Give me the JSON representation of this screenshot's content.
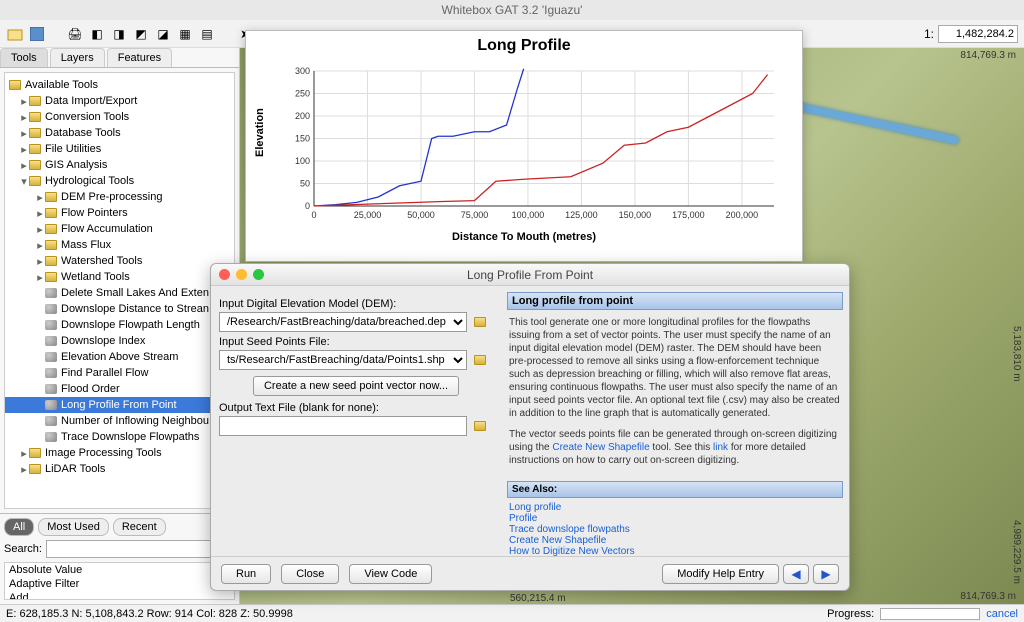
{
  "window_title": "Whitebox GAT 3.2 'Iguazu'",
  "scale_label": "1:",
  "scale_value": "1,482,284.2",
  "tabs": {
    "tools": "Tools",
    "layers": "Layers",
    "features": "Features"
  },
  "tree": {
    "root": "Available Tools",
    "data_import": "Data Import/Export",
    "conversion": "Conversion Tools",
    "database": "Database Tools",
    "file_util": "File Utilities",
    "gis": "GIS Analysis",
    "hydro": "Hydrological Tools",
    "dem_pre": "DEM Pre-processing",
    "flow_ptr": "Flow Pointers",
    "flow_acc": "Flow Accumulation",
    "mass_flux": "Mass Flux",
    "watershed": "Watershed Tools",
    "wetland": "Wetland Tools",
    "del_lakes": "Delete Small Lakes And Exten",
    "downslope_dist": "Downslope Distance to Strean",
    "downslope_fp": "Downslope Flowpath Length",
    "downslope_idx": "Downslope Index",
    "elev_above": "Elevation Above Stream",
    "find_par": "Find Parallel Flow",
    "flood_order": "Flood Order",
    "long_profile": "Long Profile From Point",
    "num_inflow": "Number of Inflowing Neighbou",
    "trace_down": "Trace Downslope Flowpaths",
    "image_proc": "Image Processing Tools",
    "lidar": "LiDAR Tools"
  },
  "filter_tabs": {
    "all": "All",
    "most": "Most Used",
    "recent": "Recent"
  },
  "search_label": "Search:",
  "filter_items": [
    "Absolute Value",
    "Adaptive Filter",
    "Add"
  ],
  "map_coords": {
    "top_right": "814,769.3 m",
    "right_side": "5,183,810 m",
    "bottom_right": "814,769.3 m",
    "right_side2": "4,989,229.5 m",
    "bottom_x": "560,215.4 m"
  },
  "status": {
    "coords": "E: 628,185.3  N: 5,108,843.2  Row: 914  Col: 828  Z: 50.9998",
    "progress_label": "Progress:",
    "cancel": "cancel"
  },
  "chart_data": {
    "type": "line",
    "title": "Long Profile",
    "xlabel": "Distance To Mouth (metres)",
    "ylabel": "Elevation",
    "xlim": [
      0,
      215000
    ],
    "ylim": [
      0,
      300
    ],
    "xticks": [
      0,
      25000,
      50000,
      75000,
      100000,
      125000,
      150000,
      175000,
      200000
    ],
    "yticks": [
      0,
      50,
      100,
      150,
      200,
      250,
      300
    ],
    "series": [
      {
        "name": "blue",
        "color": "#2233cc",
        "points": [
          [
            0,
            0
          ],
          [
            10000,
            3
          ],
          [
            20000,
            8
          ],
          [
            30000,
            20
          ],
          [
            40000,
            45
          ],
          [
            50000,
            55
          ],
          [
            55000,
            150
          ],
          [
            58000,
            155
          ],
          [
            65000,
            155
          ],
          [
            75000,
            165
          ],
          [
            82000,
            165
          ],
          [
            90000,
            180
          ],
          [
            95000,
            260
          ],
          [
            98000,
            305
          ]
        ]
      },
      {
        "name": "red",
        "color": "#cc2222",
        "points": [
          [
            0,
            0
          ],
          [
            30000,
            5
          ],
          [
            60000,
            10
          ],
          [
            75000,
            12
          ],
          [
            85000,
            55
          ],
          [
            100000,
            60
          ],
          [
            120000,
            65
          ],
          [
            135000,
            95
          ],
          [
            145000,
            135
          ],
          [
            155000,
            140
          ],
          [
            165000,
            165
          ],
          [
            175000,
            175
          ],
          [
            185000,
            200
          ],
          [
            195000,
            225
          ],
          [
            205000,
            250
          ],
          [
            212000,
            292
          ]
        ]
      }
    ]
  },
  "dialog": {
    "title": "Long Profile From Point",
    "dem_label": "Input Digital Elevation Model (DEM):",
    "dem_value": "/Research/FastBreaching/data/breached.dep",
    "seed_label": "Input Seed Points File:",
    "seed_value": "ts/Research/FastBreaching/data/Points1.shp",
    "create_seed_btn": "Create a new seed point vector now...",
    "output_label": "Output Text File (blank for none):",
    "output_value": "",
    "help_title": "Long profile from point",
    "help_text1": "This tool generate one or more longitudinal profiles for the flowpaths issuing from a set of vector points. The user must specify the name of an input digital elevation model (DEM) raster. The DEM should have been pre-processed to remove all sinks using a flow-enforcement technique such as depression breaching or filling, which will also remove flat areas, ensuring continuous flowpaths. The user must also specify the name of an input seed points vector file. An optional text file (.csv) may also be created in addition to the line graph that is automatically generated.",
    "help_text2a": "The vector seeds points file can be generated through on-screen digitizing using the ",
    "help_link1": "Create New Shapefile",
    "help_text2b": " tool. See this ",
    "help_link2": "link",
    "help_text2c": " for more detailed instructions on how to carry out on-screen digitizing.",
    "see_also": "See Also:",
    "links": [
      "Long profile",
      "Profile",
      "Trace downslope flowpaths",
      "Create New Shapefile",
      "How to Digitize New Vectors"
    ],
    "run": "Run",
    "close": "Close",
    "view_code": "View Code",
    "modify_help": "Modify Help Entry"
  }
}
